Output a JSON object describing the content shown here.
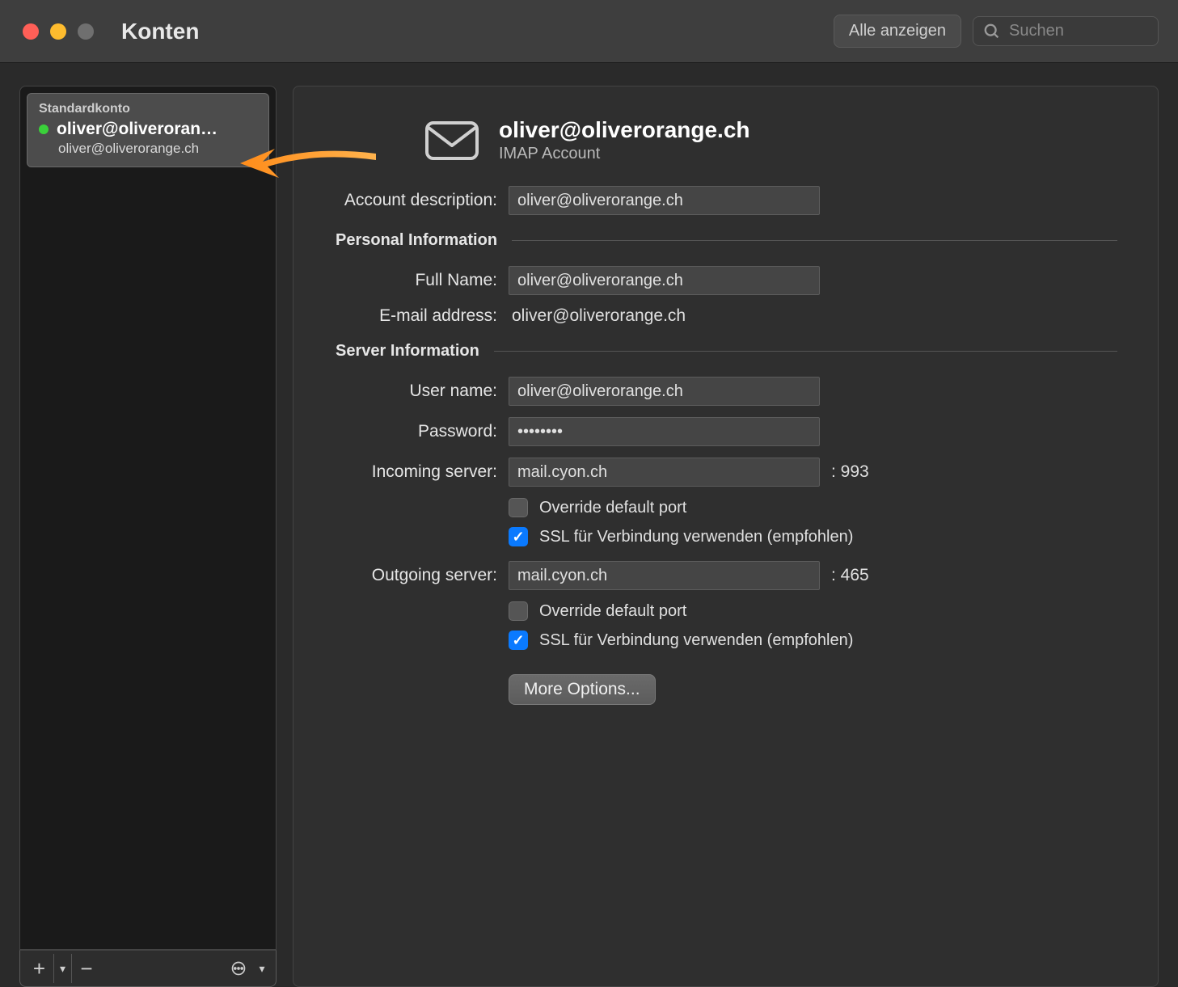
{
  "window": {
    "title": "Konten"
  },
  "toolbar": {
    "show_all": "Alle anzeigen",
    "search_placeholder": "Suchen"
  },
  "sidebar": {
    "account": {
      "default_label": "Standardkonto",
      "name": "oliver@oliveroran…",
      "email": "oliver@oliverorange.ch"
    }
  },
  "details": {
    "heading": "oliver@oliverorange.ch",
    "subheading": "IMAP Account",
    "account_description_label": "Account description:",
    "account_description_value": "oliver@oliverorange.ch",
    "personal_section": "Personal Information",
    "full_name_label": "Full Name:",
    "full_name_value": "oliver@oliverorange.ch",
    "email_label": "E-mail address:",
    "email_value": "oliver@oliverorange.ch",
    "server_section": "Server Information",
    "user_name_label": "User name:",
    "user_name_value": "oliver@oliverorange.ch",
    "password_label": "Password:",
    "password_value": "••••••••",
    "incoming_label": "Incoming server:",
    "incoming_value": "mail.cyon.ch",
    "incoming_port": ": 993",
    "override_port_label": "Override default port",
    "ssl_label": "SSL für Verbindung verwenden (empfohlen)",
    "outgoing_label": "Outgoing server:",
    "outgoing_value": "mail.cyon.ch",
    "outgoing_port": ": 465",
    "more_options": "More Options..."
  }
}
